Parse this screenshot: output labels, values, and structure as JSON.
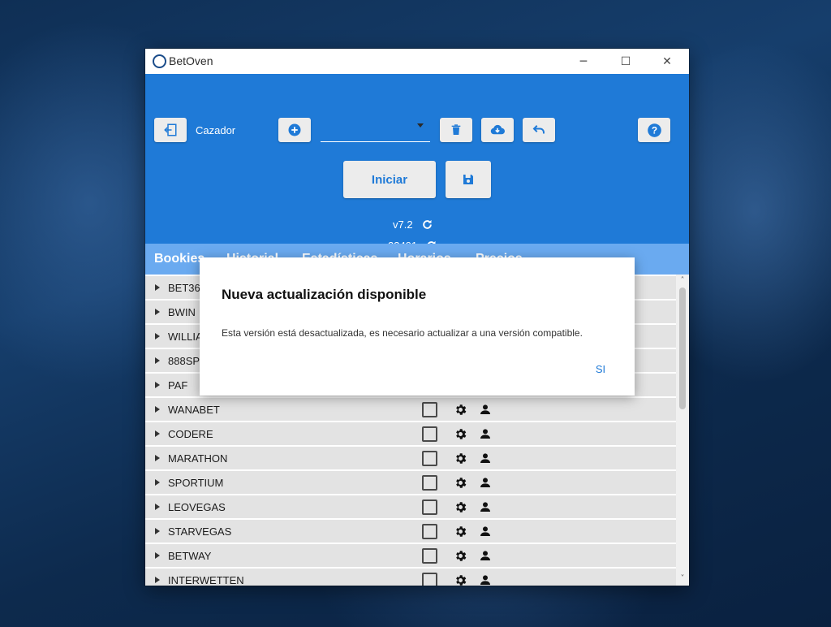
{
  "window": {
    "title": "BetOven",
    "controls": {
      "minimize": "─",
      "maximize": "☐",
      "close": "✕"
    }
  },
  "header": {
    "mode_label": "Cazador",
    "dropdown_value": "",
    "start_label": "Iniciar",
    "version": "v7.2",
    "build": "23491"
  },
  "tabs": [
    "Bookies",
    "Historial",
    "Estadísticas",
    "Horarios",
    "Precios"
  ],
  "bookies": [
    "BET365",
    "BWIN",
    "WILLIAMHILL",
    "888SPORT",
    "PAF",
    "WANABET",
    "CODERE",
    "MARATHON",
    "SPORTIUM",
    "LEOVEGAS",
    "STARVEGAS",
    "BETWAY",
    "INTERWETTEN"
  ],
  "dialog": {
    "title": "Nueva actualización disponible",
    "message": "Esta versión está desactualizada, es necesario actualizar a una versión compatible.",
    "button": "SI"
  },
  "colors": {
    "header_blue": "#1f7ad7",
    "tab_bar_blue": "#6aaaf0",
    "row_gray": "#e3e3e3",
    "button_gray": "#ececec",
    "accent_text": "#1f7ad7"
  },
  "icons": {
    "exit": "exit-icon",
    "add": "add-circle-icon",
    "delete": "trash-icon",
    "download": "cloud-download-icon",
    "undo": "undo-icon",
    "help": "help-icon",
    "save": "save-icon",
    "refresh": "refresh-icon",
    "settings": "gear-icon",
    "user": "user-icon"
  }
}
